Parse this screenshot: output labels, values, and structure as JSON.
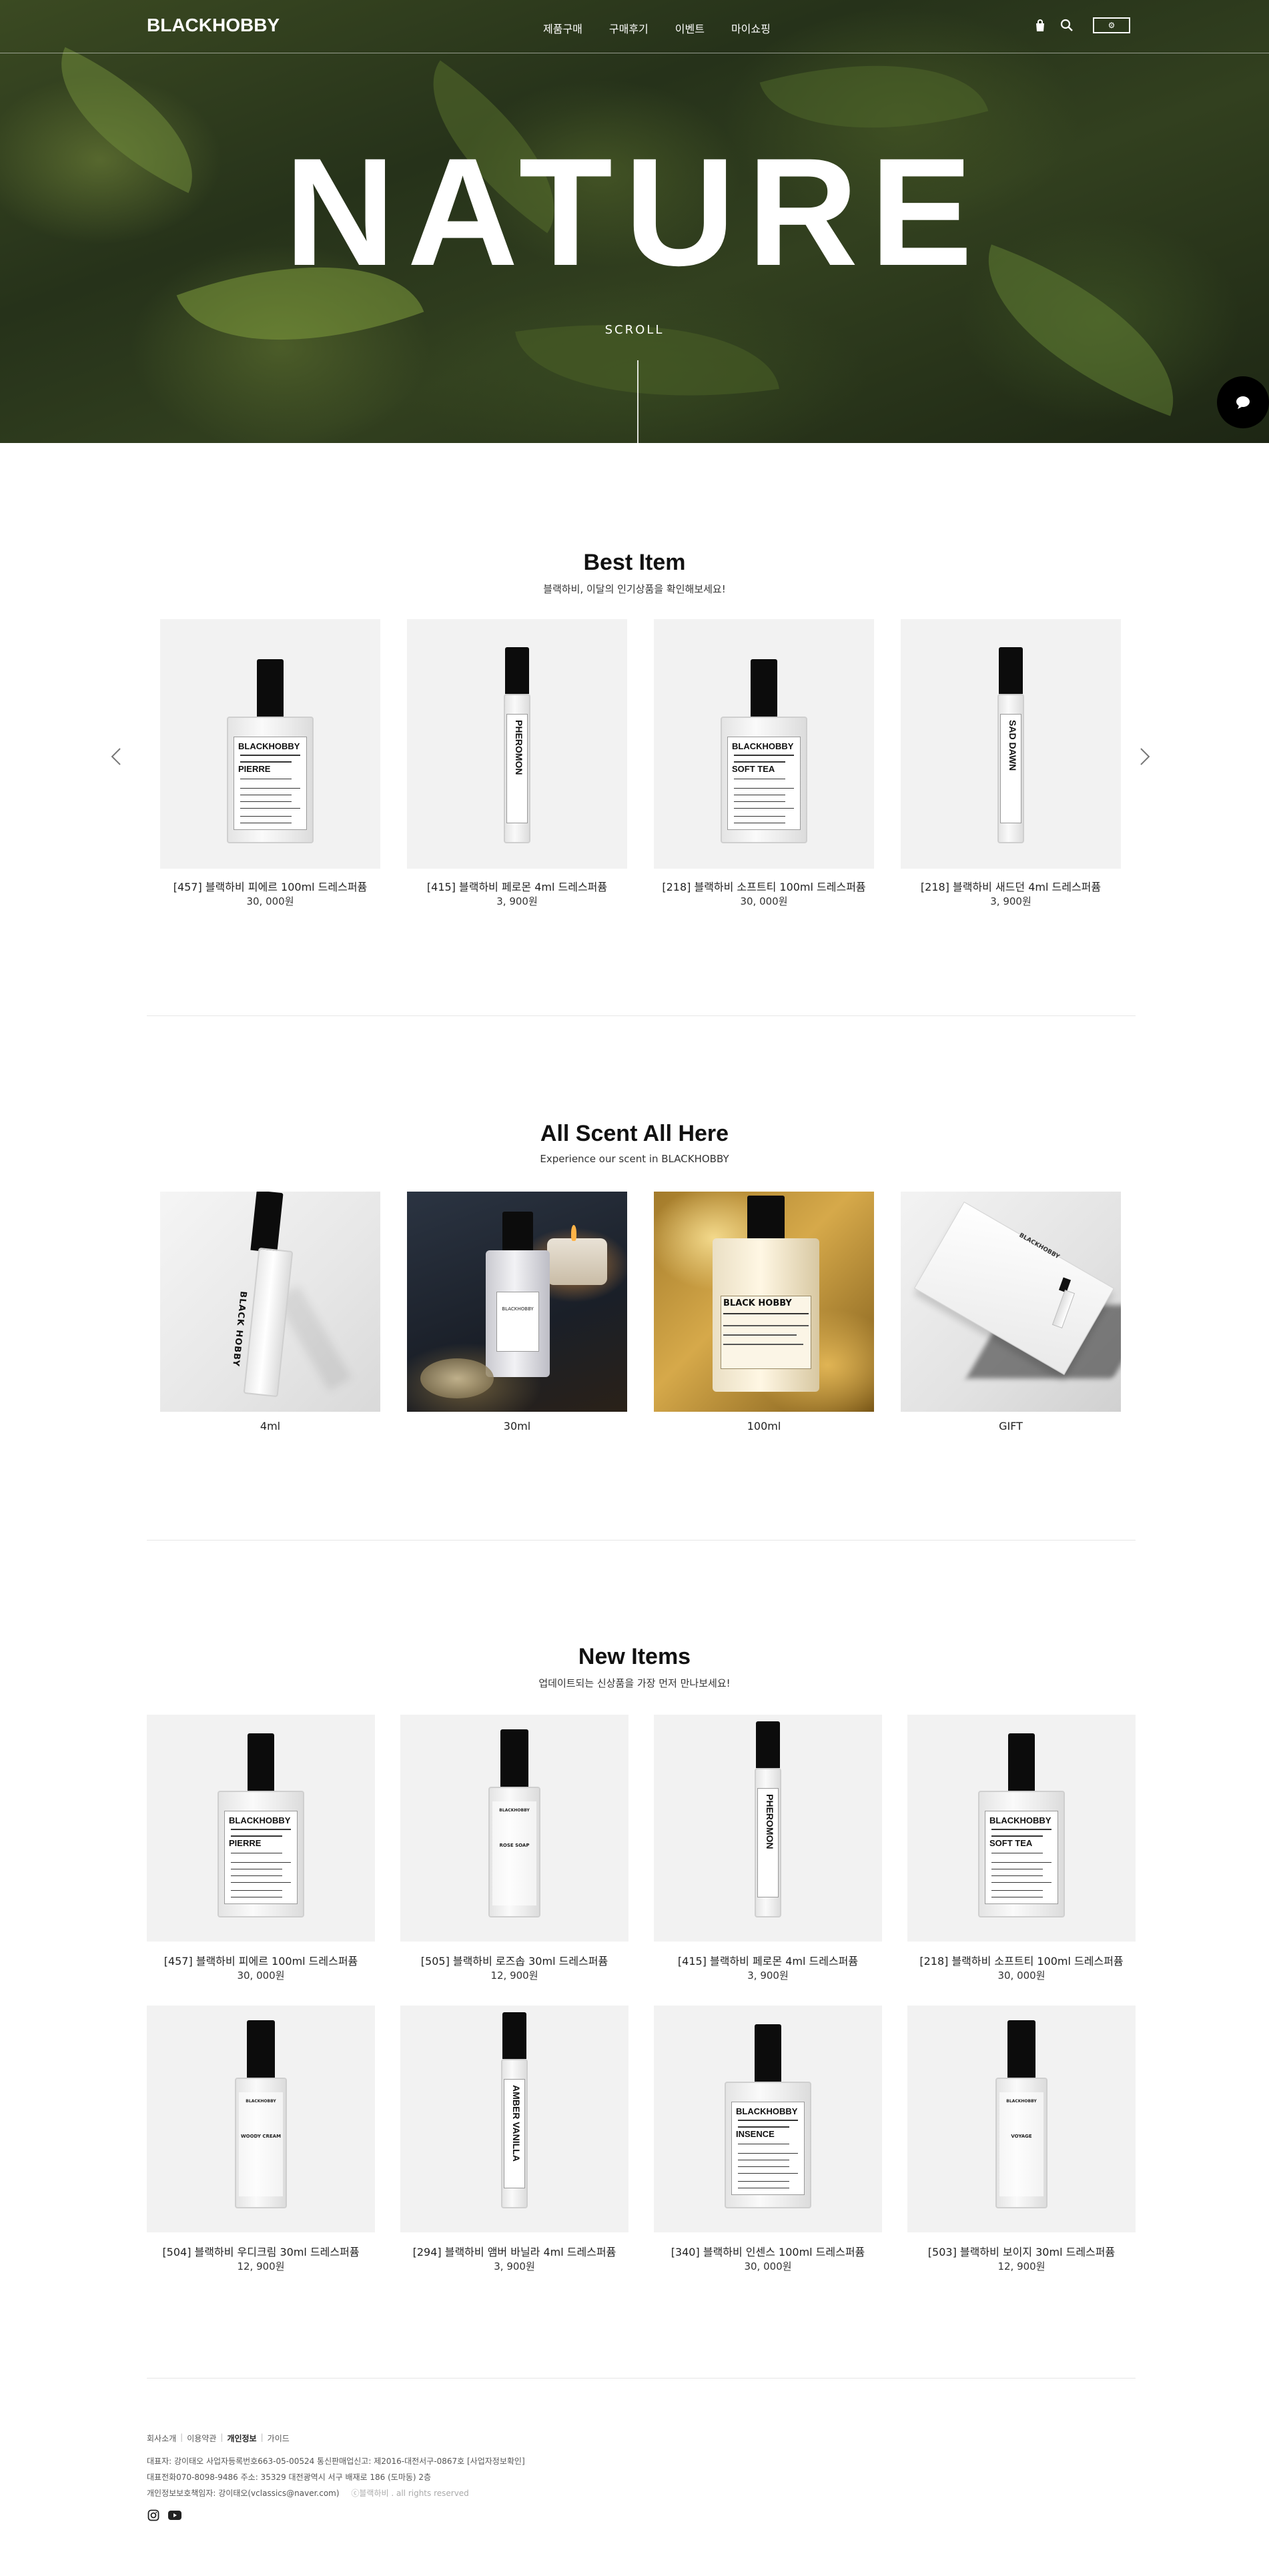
{
  "header": {
    "logo": "BLACKHOBBY",
    "menu": [
      "제품구매",
      "구매후기",
      "이벤트",
      "마이쇼핑"
    ],
    "lang": "⚙"
  },
  "hero": {
    "title": "NATURE",
    "scroll_label": "SCROLL"
  },
  "best": {
    "title": "Best Item",
    "subtitle": "블랙하비, 이달의 인기상품을 확인해보세요!",
    "items": [
      {
        "name": "[457] 블랙하비 피에르 100ml 드레스퍼퓸",
        "price": "30, 000원",
        "bottle_label": "PIERRE"
      },
      {
        "name": "[415] 블랙하비 페로몬 4ml 드레스퍼퓸",
        "price": "3, 900원",
        "bottle_label": "PHEROMON"
      },
      {
        "name": "[218] 블랙하비 소프트티 100ml 드레스퍼퓸",
        "price": "30, 000원",
        "bottle_label": "SOFT TEA"
      },
      {
        "name": "[218] 블랙하비 새드던 4ml 드레스퍼퓸",
        "price": "3, 900원",
        "bottle_label": "SAD DAWN"
      }
    ]
  },
  "scent": {
    "title": "All Scent All Here",
    "subtitle": "Experience our scent in BLACKHOBBY",
    "items": [
      {
        "label": "4ml",
        "bottle_text": "BLACK HOBBY"
      },
      {
        "label": "30ml",
        "bottle_text": "BLACKHOBBY"
      },
      {
        "label": "100ml",
        "bottle_text": "BLACK HOBBY"
      },
      {
        "label": "GIFT",
        "bottle_text": "BLACKHOBBY"
      }
    ]
  },
  "new_items": {
    "title": "New Items",
    "subtitle": "업데이트되는 신상품을 가장 먼저 만나보세요!",
    "items": [
      {
        "name": "[457] 블랙하비 피에르 100ml 드레스퍼퓸",
        "price": "30, 000원",
        "bottle_label": "PIERRE"
      },
      {
        "name": "[505] 블랙하비 로즈솝 30ml 드레스퍼퓸",
        "price": "12, 900원",
        "bottle_label": "ROSE SOAP"
      },
      {
        "name": "[415] 블랙하비 페로몬 4ml 드레스퍼퓸",
        "price": "3, 900원",
        "bottle_label": "PHEROMON"
      },
      {
        "name": "[218] 블랙하비 소프트티 100ml 드레스퍼퓸",
        "price": "30, 000원",
        "bottle_label": "SOFT TEA"
      },
      {
        "name": "[504] 블랙하비 우디크림 30ml 드레스퍼퓸",
        "price": "12, 900원",
        "bottle_label": "WOODY CREAM"
      },
      {
        "name": "[294] 블랙하비 앰버 바닐라 4ml 드레스퍼퓸",
        "price": "3, 900원",
        "bottle_label": "AMBER VANILLA"
      },
      {
        "name": "[340] 블랙하비 인센스 100ml 드레스퍼퓸",
        "price": "30, 000원",
        "bottle_label": "INSENCE"
      },
      {
        "name": "[503] 블랙하비 보이지 30ml 드레스퍼퓸",
        "price": "12, 900원",
        "bottle_label": "VOYAGE"
      }
    ]
  },
  "bottle_brand": "BLACKHOBBY",
  "footer": {
    "links": [
      "회사소개",
      "이용약관",
      "개인정보",
      "가이드"
    ],
    "line1": "대표자: 강이태오    사업자등록번호663-05-00524    통신판매업신고: 제2016-대전서구-0867호 [사업자정보확인]",
    "line2": "대표전화070-8098-9486    주소: 35329 대전광역시 서구 배재로 186 (도마동) 2층",
    "line3": "개인정보보호책임자: 강이태오(vclassics@naver.com)",
    "copyright": "ⓒ블랙하비 . all rights reserved"
  },
  "colors": {
    "accent": "#000000",
    "thumb_bg": "#f2f2f2"
  }
}
